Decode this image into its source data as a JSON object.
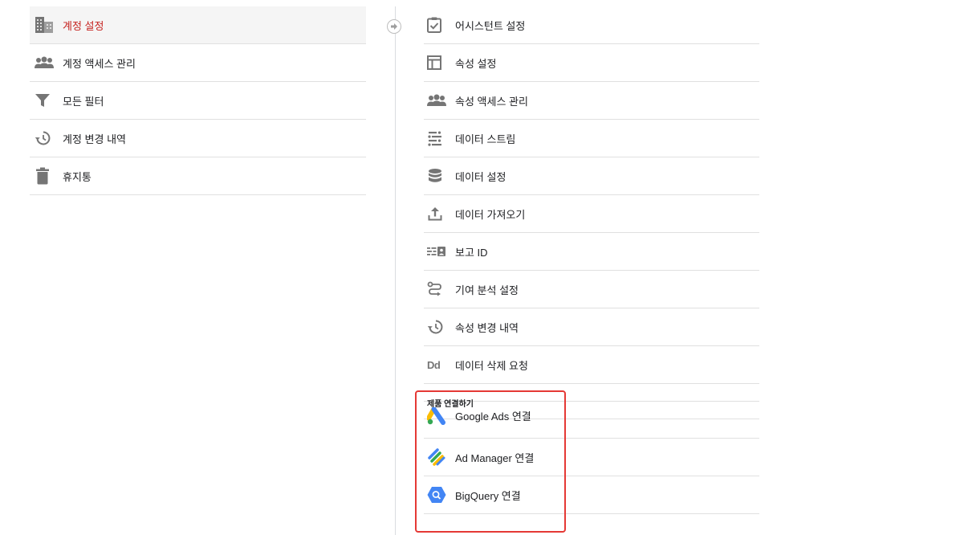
{
  "account_menu": {
    "items": [
      {
        "label": "계정 설정",
        "icon": "building-icon",
        "active": true
      },
      {
        "label": "계정 액세스 관리",
        "icon": "people-icon"
      },
      {
        "label": "모든 필터",
        "icon": "filter-icon"
      },
      {
        "label": "계정 변경 내역",
        "icon": "history-icon"
      },
      {
        "label": "휴지통",
        "icon": "trash-icon"
      }
    ]
  },
  "property_menu": {
    "items": [
      {
        "label": "어시스턴트 설정",
        "icon": "checklist-icon"
      },
      {
        "label": "속성 설정",
        "icon": "layout-icon"
      },
      {
        "label": "속성 액세스 관리",
        "icon": "people-icon"
      },
      {
        "label": "데이터 스트림",
        "icon": "streams-icon"
      },
      {
        "label": "데이터 설정",
        "icon": "database-icon"
      },
      {
        "label": "데이터 가져오기",
        "icon": "upload-icon"
      },
      {
        "label": "보고 ID",
        "icon": "reporting-id-icon"
      },
      {
        "label": "기여 분석 설정",
        "icon": "attribution-icon"
      },
      {
        "label": "속성 변경 내역",
        "icon": "history-icon"
      },
      {
        "label": "데이터 삭제 요청",
        "icon": "data-deletion-icon",
        "icon_text": "Dd"
      }
    ],
    "product_links": {
      "title": "제품 연결하기",
      "items": [
        {
          "label": "Google Ads 연결",
          "icon": "google-ads-icon"
        },
        {
          "label": "Ad Manager 연결",
          "icon": "ad-manager-icon"
        },
        {
          "label": "BigQuery 연결",
          "icon": "bigquery-icon"
        }
      ]
    }
  },
  "colors": {
    "active_text": "#c5221f",
    "icon_gray": "#757575",
    "divider": "#e0e0e0",
    "highlight": "#e53935",
    "google_blue": "#4285f4",
    "google_yellow": "#fbbc04",
    "google_green": "#34a853"
  }
}
